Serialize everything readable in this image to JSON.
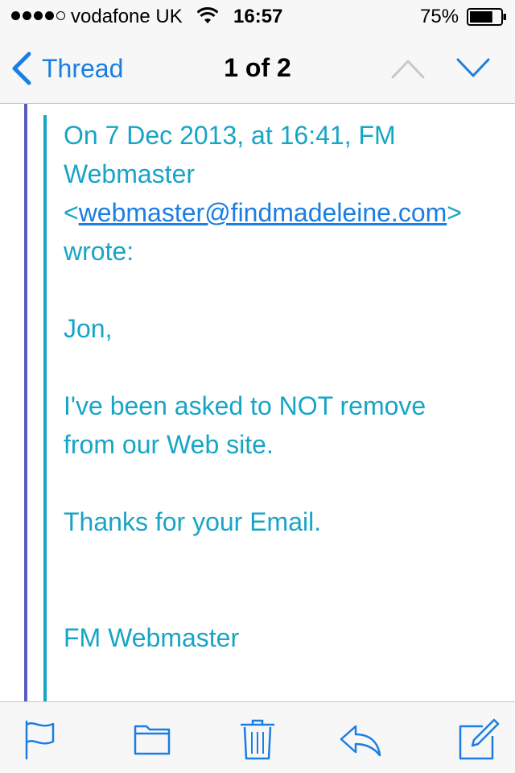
{
  "status_bar": {
    "carrier": "vodafone UK",
    "time": "16:57",
    "battery_percent": "75%",
    "signal_bars": 4,
    "signal_max": 5,
    "battery_level": 0.75
  },
  "nav": {
    "back_label": "Thread",
    "title": "1 of 2"
  },
  "message": {
    "header_line1": "On 7 Dec 2013, at 16:41, FM",
    "header_line2": "Webmaster",
    "email_open": "<",
    "email": "webmaster@findmadeleine.com",
    "email_close": ">",
    "wrote": "wrote:",
    "greeting": "Jon,",
    "body_line1": "I've been asked to NOT remove",
    "body_line2": "from our Web site.",
    "thanks": "Thanks for your Email.",
    "signature": "FM Webmaster"
  },
  "toolbar": {
    "icons": [
      "flag-icon",
      "folder-icon",
      "trash-icon",
      "reply-icon",
      "compose-icon"
    ]
  },
  "colors": {
    "accent": "#1a7ee2",
    "quote_text": "#17a5c6",
    "outer_quote_bar": "#5b5bbf",
    "bar_background": "#f7f7f7"
  }
}
